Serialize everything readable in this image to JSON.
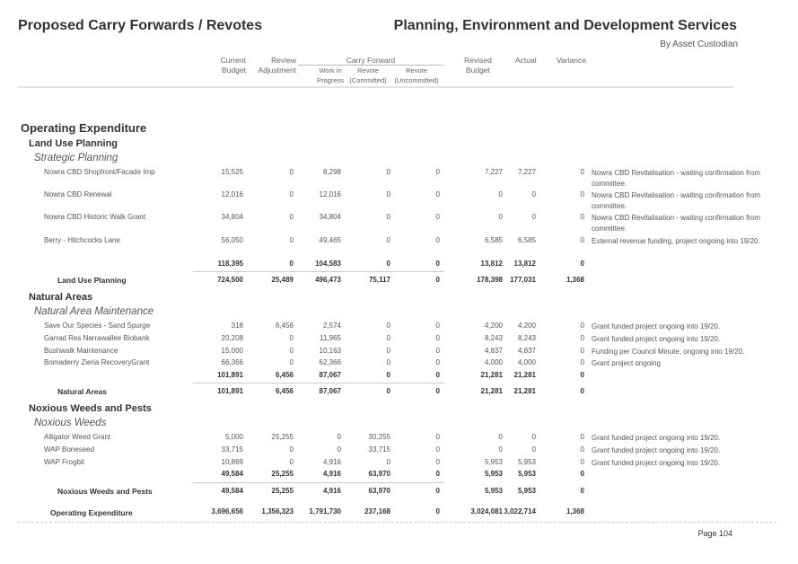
{
  "header": {
    "title": "Proposed Carry Forwards / Revotes",
    "department": "Planning, Environment and Development Services",
    "subtitle": "By Asset Custodian"
  },
  "columns": {
    "current_budget": [
      "Current",
      "Budget"
    ],
    "review_adjustment": [
      "Review",
      "Adjustment"
    ],
    "carry_forward_group": "Carry Forward",
    "work_in_progress": [
      "Work in",
      "Progress"
    ],
    "revote_committed": [
      "Revote",
      "(Committed)"
    ],
    "revote_uncommitted": [
      "Revote",
      "(Uncommitted)"
    ],
    "revised_budget": [
      "Revised",
      "Budget"
    ],
    "actual": "Actual",
    "variance": "Variance"
  },
  "section": {
    "title": "Operating Expenditure",
    "total_label": "Operating Expenditure",
    "total": [
      "3,696,656",
      "1,356,323",
      "1,791,730",
      "237,168",
      "0",
      "3,024,081",
      "3,022,714",
      "1,368"
    ]
  },
  "groups": [
    {
      "title": "Land Use Planning",
      "subgroup": "Strategic Planning",
      "rows": [
        {
          "name": "Nowra CBD Shopfront/Facade Imp",
          "values": [
            "15,525",
            "0",
            "8,298",
            "0",
            "0",
            "7,227",
            "7,227",
            "0"
          ],
          "comment": "Nowra CBD Revitalisation - waiting confirmation from committee."
        },
        {
          "name": "Nowra CBD Renewal",
          "values": [
            "12,016",
            "0",
            "12,016",
            "0",
            "0",
            "0",
            "0",
            "0"
          ],
          "comment": "Nowra CBD Revitalisation - waiting confirmation from committee."
        },
        {
          "name": "Nowra CBD Historic Walk Grant",
          "values": [
            "34,804",
            "0",
            "34,804",
            "0",
            "0",
            "0",
            "0",
            "0"
          ],
          "comment": "Nowra CBD Revitalisation - waiting confirmation from committee."
        },
        {
          "name": "Berry - Hitchcocks Lane",
          "values": [
            "56,050",
            "0",
            "49,465",
            "0",
            "0",
            "6,585",
            "6,585",
            "0"
          ],
          "comment": "External revenue funding, project ongoing into 19/20."
        }
      ],
      "subtotal": [
        "118,395",
        "0",
        "104,583",
        "0",
        "0",
        "13,812",
        "13,812",
        "0"
      ],
      "total_label": "Land Use Planning",
      "total": [
        "724,500",
        "25,489",
        "496,473",
        "75,117",
        "0",
        "178,398",
        "177,031",
        "1,368"
      ]
    },
    {
      "title": "Natural Areas",
      "subgroup": "Natural Area Maintenance",
      "rows": [
        {
          "name": "Save Our Species - Sand Spurge",
          "values": [
            "318",
            "6,456",
            "2,574",
            "0",
            "0",
            "4,200",
            "4,200",
            "0"
          ],
          "comment": "Grant funded project ongoing into 19/20."
        },
        {
          "name": "Garrad Res Narrawallee Biobank",
          "values": [
            "20,208",
            "0",
            "11,965",
            "0",
            "0",
            "8,243",
            "8,243",
            "0"
          ],
          "comment": "Grant funded project ongoing into 19/20."
        },
        {
          "name": "Bushwalk Maintenance",
          "values": [
            "15,000",
            "0",
            "10,163",
            "0",
            "0",
            "4,837",
            "4,837",
            "0"
          ],
          "comment": "Funding per Council Minute, ongoing into 19/20."
        },
        {
          "name": "Bomaderry Zieria RecoveryGrant",
          "values": [
            "66,366",
            "0",
            "62,366",
            "0",
            "0",
            "4,000",
            "4,000",
            "0"
          ],
          "comment": "Grant project ongoing"
        }
      ],
      "subtotal": [
        "101,891",
        "6,456",
        "87,067",
        "0",
        "0",
        "21,281",
        "21,281",
        "0"
      ],
      "total_label": "Natural Areas",
      "total": [
        "101,891",
        "6,456",
        "87,067",
        "0",
        "0",
        "21,281",
        "21,281",
        "0"
      ]
    },
    {
      "title": "Noxious Weeds and Pests",
      "subgroup": "Noxious Weeds",
      "rows": [
        {
          "name": "Alligator Weed Grant",
          "values": [
            "5,000",
            "25,255",
            "0",
            "30,255",
            "0",
            "0",
            "0",
            "0"
          ],
          "comment": "Grant funded project ongoing into 19/20."
        },
        {
          "name": "WAP Boneseed",
          "values": [
            "33,715",
            "0",
            "0",
            "33,715",
            "0",
            "0",
            "0",
            "0"
          ],
          "comment": "Grant funded project ongoing into 19/20."
        },
        {
          "name": "WAP Frogbit",
          "values": [
            "10,869",
            "0",
            "4,916",
            "0",
            "0",
            "5,953",
            "5,953",
            "0"
          ],
          "comment": "Grant funded project ongoing into 19/20."
        }
      ],
      "subtotal": [
        "49,584",
        "25,255",
        "4,916",
        "63,970",
        "0",
        "5,953",
        "5,953",
        "0"
      ],
      "total_label": "Noxious Weeds and Pests",
      "total": [
        "49,584",
        "25,255",
        "4,916",
        "63,970",
        "0",
        "5,953",
        "5,953",
        "0"
      ]
    }
  ],
  "footer": {
    "page": "Page 104"
  }
}
